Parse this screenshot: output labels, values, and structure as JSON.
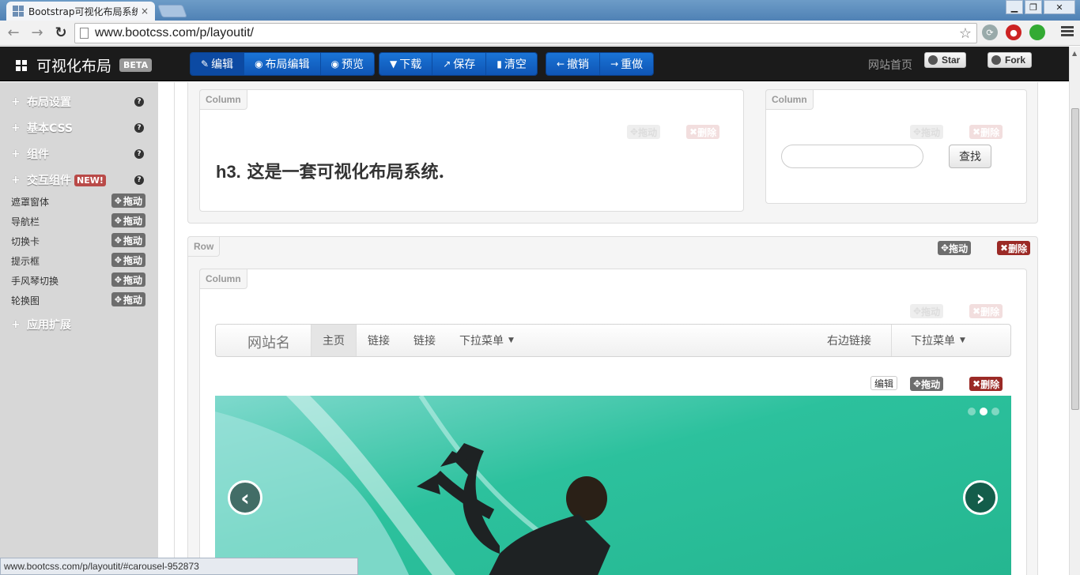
{
  "browser": {
    "tab_title": "Bootstrap可视化布局系统",
    "tab_close": "×",
    "url": "www.bootcss.com/p/layoutit/",
    "status_url": "www.bootcss.com/p/layoutit/#carousel-952873"
  },
  "appbar": {
    "brand": "可视化布局",
    "beta": "BETA",
    "group1": [
      {
        "icon": "edit-icon",
        "glyph": "✎",
        "label": "编辑"
      },
      {
        "icon": "eye-edit-icon",
        "glyph": "◉",
        "label": "布局编辑"
      },
      {
        "icon": "eye-icon",
        "glyph": "◉",
        "label": "预览"
      }
    ],
    "group2": [
      {
        "icon": "chevron-down-icon",
        "glyph": "▼",
        "label": "下载"
      },
      {
        "icon": "share-icon",
        "glyph": "↗",
        "label": "保存"
      },
      {
        "icon": "trash-icon",
        "glyph": "▮",
        "label": "清空"
      }
    ],
    "group3": [
      {
        "icon": "arrow-left-icon",
        "glyph": "←",
        "label": "撤销"
      },
      {
        "icon": "arrow-right-icon",
        "glyph": "→",
        "label": "重做"
      }
    ],
    "site_home": "网站首页",
    "star": "Star",
    "fork": "Fork"
  },
  "sidebar": {
    "sections": [
      {
        "label": "布局设置",
        "help": "?"
      },
      {
        "label": "基本CSS",
        "help": "?"
      },
      {
        "label": "组件",
        "help": "?"
      },
      {
        "label": "交互组件",
        "help": "?",
        "badge": "NEW!"
      }
    ],
    "items": [
      {
        "label": "遮罩窗体"
      },
      {
        "label": "导航栏"
      },
      {
        "label": "切换卡"
      },
      {
        "label": "提示框"
      },
      {
        "label": "手风琴切换"
      },
      {
        "label": "轮换图"
      }
    ],
    "drag_label": "拖动",
    "extensions": "应用扩展"
  },
  "main": {
    "row_tag": "Row",
    "column_tag": "Column",
    "drag_label": "拖动",
    "delete_label": "删除",
    "edit_label": "编辑",
    "heading_prefix": "h3.",
    "heading_text": " 这是一套可视化布局系统.",
    "search_button": "查找",
    "navbar": {
      "brand": "网站名",
      "active": "主页",
      "link1": "链接",
      "link2": "链接",
      "dropdown": "下拉菜单",
      "right_link": "右边链接",
      "right_dropdown": "下拉菜单"
    },
    "carousel": {
      "prev": "‹",
      "next": "›",
      "active_slide": 2,
      "slide_count": 3
    }
  }
}
